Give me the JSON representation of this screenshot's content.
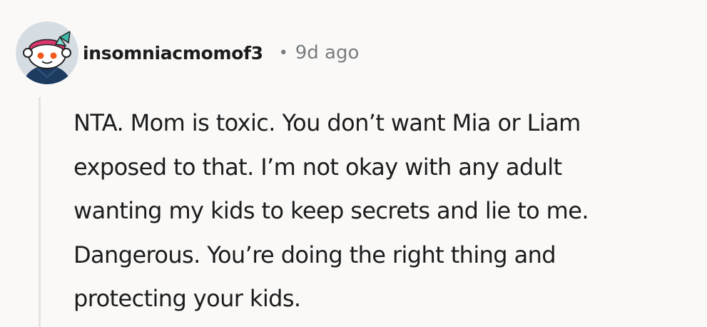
{
  "comment": {
    "author": "insomniacmomof3",
    "separator": "•",
    "timestamp": "9d ago",
    "body_lines": [
      "NTA. Mom is toxic. You don’t want Mia or Liam",
      "exposed to that. I’m not okay with any adult",
      "wanting my kids to keep secrets and lie to me.",
      "Dangerous. You’re doing the right thing and",
      "protecting your kids."
    ]
  },
  "colors": {
    "background": "#faf9f8",
    "text": "#1c1c1c",
    "meta": "#787c7e",
    "thread_line": "#e6e3df",
    "avatar_headband": "#d9366b",
    "avatar_shirt": "#1d3a5f"
  },
  "icons": {
    "avatar": "snoo-avatar-icon"
  }
}
